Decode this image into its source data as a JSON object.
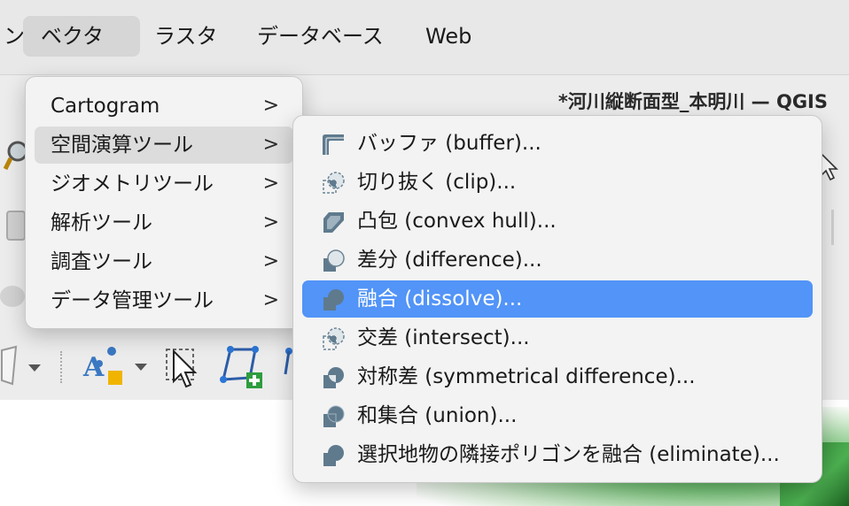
{
  "menubar": {
    "items": [
      {
        "label": "ン"
      },
      {
        "label": "ベクタ"
      },
      {
        "label": "ラスタ"
      },
      {
        "label": "データベース"
      },
      {
        "label": "Web"
      }
    ]
  },
  "window": {
    "title": "*河川縦断面型_本明川 — QGIS"
  },
  "vector_menu": {
    "items": [
      {
        "label": "Cartogram"
      },
      {
        "label": "空間演算ツール"
      },
      {
        "label": "ジオメトリツール"
      },
      {
        "label": "解析ツール"
      },
      {
        "label": "調査ツール"
      },
      {
        "label": "データ管理ツール"
      }
    ]
  },
  "geoprocessing_menu": {
    "items": [
      {
        "label": "バッファ (buffer)...",
        "icon": "buffer-icon"
      },
      {
        "label": "切り抜く (clip)...",
        "icon": "clip-icon"
      },
      {
        "label": "凸包 (convex hull)...",
        "icon": "convex-hull-icon"
      },
      {
        "label": "差分 (difference)...",
        "icon": "difference-icon"
      },
      {
        "label": "融合 (dissolve)...",
        "icon": "dissolve-icon"
      },
      {
        "label": "交差 (intersect)...",
        "icon": "intersect-icon"
      },
      {
        "label": "対称差 (symmetrical difference)...",
        "icon": "symmetrical-difference-icon"
      },
      {
        "label": "和集合 (union)...",
        "icon": "union-icon"
      },
      {
        "label": "選択地物の隣接ポリゴンを融合 (eliminate)...",
        "icon": "eliminate-icon"
      }
    ]
  },
  "colors": {
    "selection": "#5294f7",
    "icon": "#5f7a8d"
  }
}
